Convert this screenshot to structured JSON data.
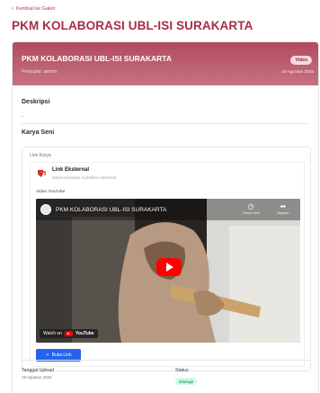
{
  "nav": {
    "back_label": "Kembali ke Galeri",
    "back_icon": "chevron-left-icon"
  },
  "page": {
    "title": "PKM KOLABORASI UBL-ISI SURAKARTA"
  },
  "banner": {
    "title": "PKM KOLABORASI UBL-ISI SURAKARTA",
    "subtitle": "Pencipta: admin",
    "type_badge": "Video",
    "date": "19 Agustus 2025"
  },
  "deskripsi": {
    "heading": "Deskripsi",
    "value": "-"
  },
  "karya": {
    "heading": "Karya Seni",
    "label": "Link Karya",
    "external": {
      "title": "Link Eksternal",
      "subtitle": "Karya tersimpan di platform eksternal",
      "icon": "external-link-icon"
    },
    "youtube_label": "Video YouTube",
    "video": {
      "title": "PKM KOLABORASI UBL-ISI SURAKARTA",
      "watch_later": "Tonton nanti",
      "share": "Bagikan",
      "watch_on": "Watch on",
      "youtube": "YouTube"
    },
    "open_button": "Buka Link"
  },
  "meta": {
    "upload_label": "Tanggal Upload",
    "upload_value": "19 Agustus 2025",
    "status_label": "Status",
    "status_value": "Disetujui"
  },
  "colors": {
    "brand": "#a72d46",
    "banner_start": "#b24a5f",
    "banner_end": "#c6737f",
    "button": "#2563eb",
    "youtube_red": "#ff0000",
    "status_green": "#047857"
  }
}
